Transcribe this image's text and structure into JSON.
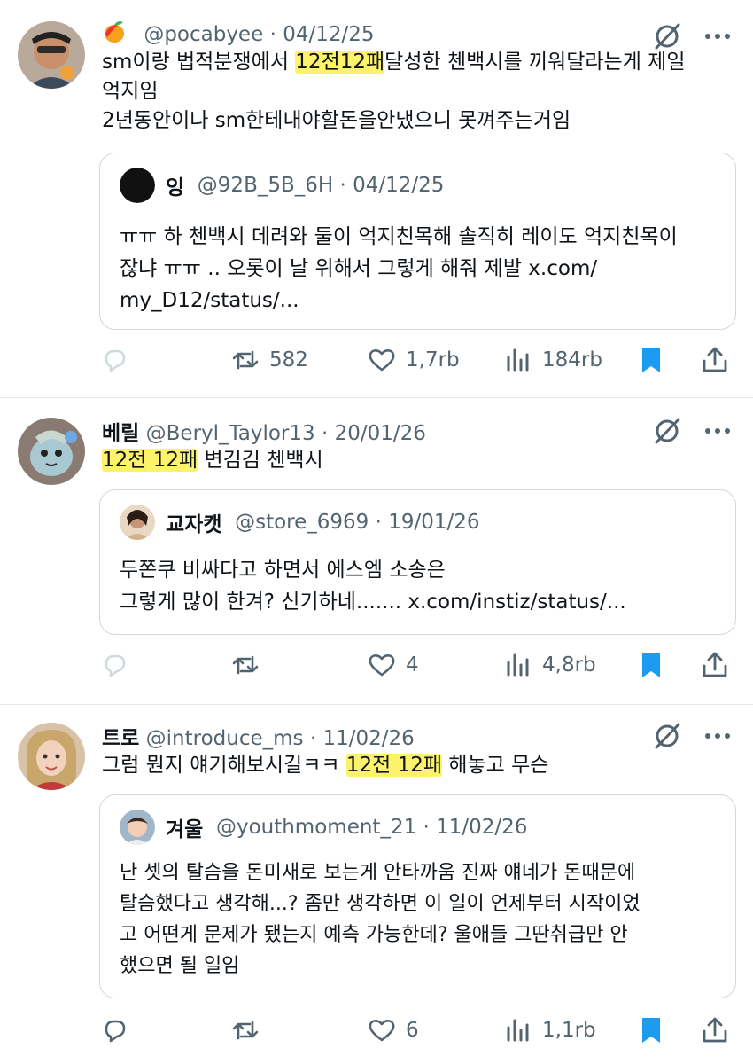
{
  "tweets": [
    {
      "name": "",
      "handle": "@pocabyee",
      "sep": "·",
      "date": "04/12/25",
      "text_lines": [
        {
          "before": "sm이랑 법적분쟁에서 ",
          "highlight": "12전12패",
          "after": "달성한 첸백시를 끼워달라는게 제일"
        },
        {
          "before": "억지임",
          "highlight": "",
          "after": ""
        },
        {
          "before": "2년동안이나 sm한테내야할돈을안냈으니 못껴주는거임",
          "highlight": "",
          "after": ""
        }
      ],
      "quote": {
        "name": "잉",
        "handle": "@92B_5B_6H",
        "sep": "·",
        "date": "04/12/25",
        "lines": [
          "ㅠㅠ 하 첸백시 데려와 둘이 억지친목해 솔직히 레이도 억지친목이",
          "잖냐 ㅠㅠ .. 오롯이 날 위해서 그렇게 해줘 제발 x.com/",
          "my_D12/status/..."
        ]
      },
      "actions": {
        "reply": "",
        "retweets": "582",
        "likes": "1,7rb",
        "views": "184rb"
      }
    },
    {
      "name": "베릴",
      "handle": "@Beryl_Taylor13",
      "sep": "·",
      "date": "20/01/26",
      "text_lines": [
        {
          "before": "",
          "highlight": "12전 12패",
          "after": " 변김김 첸백시"
        }
      ],
      "quote": {
        "name": "교자캣",
        "handle": "@store_6969",
        "sep": "·",
        "date": "19/01/26",
        "lines": [
          "두쫀쿠 비싸다고 하면서 에스엠 소송은",
          "그렇게 많이 한겨? 신기하네....... x.com/instiz/status/..."
        ]
      },
      "actions": {
        "reply": "",
        "retweets": "",
        "likes": "4",
        "views": "4,8rb"
      }
    },
    {
      "name": "트로",
      "handle": "@introduce_ms",
      "sep": "·",
      "date": "11/02/26",
      "text_lines": [
        {
          "before": "그럼 뭔지 얘기해보시길ㅋㅋ ",
          "highlight": "12전 12패",
          "after": " 해놓고 무슨"
        }
      ],
      "quote": {
        "name": "겨울",
        "handle": "@youthmoment_21",
        "sep": "·",
        "date": "11/02/26",
        "lines": [
          "난 셋의 탈슴을 돈미새로 보는게 안타까움 진짜 얘네가 돈때문에",
          "탈슴했다고 생각해...? 좀만 생각하면 이 일이 언제부터 시작이었",
          "고 어떤게 문제가 됐는지 예측 가능한데?  울애들 그딴취급만 안",
          "했으면 될 일임"
        ]
      },
      "actions": {
        "reply": "",
        "retweets": "",
        "likes": "6",
        "views": "1,1rb"
      }
    }
  ],
  "colors": {
    "highlight": "#fdf36b",
    "bookmark": "#1d9bf0",
    "secondary": "#536471",
    "border": "#cfd9de"
  },
  "icons": [
    "mango-emoji-icon",
    "grok-icon",
    "more-icon",
    "reply-icon",
    "retweet-icon",
    "like-icon",
    "views-icon",
    "bookmark-icon",
    "share-icon"
  ]
}
